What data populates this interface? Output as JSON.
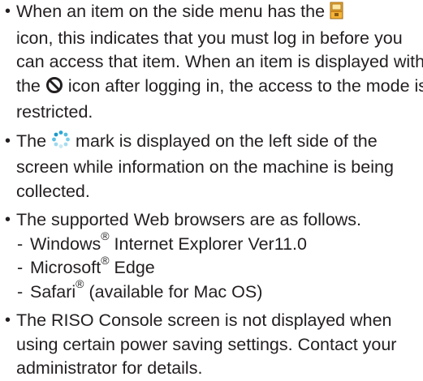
{
  "notes": [
    {
      "part1": "When an item on the side menu has the",
      "part2": "icon, this indicates that you must log in before you can access that item. When an item is displayed with the",
      "part3": "icon after logging in, the access to the mode is restricted."
    },
    {
      "part1": "The",
      "part2": "mark is displayed on the left side of the screen while information on the machine is being collected."
    },
    {
      "intro": "The supported Web browsers are as follows.",
      "browsers": [
        {
          "name": "Windows",
          "rest": "Internet Explorer Ver11.0"
        },
        {
          "name": "Microsoft",
          "rest": "Edge"
        },
        {
          "name": "Safari",
          "rest": "(available for Mac OS)"
        }
      ]
    },
    {
      "text": "The RISO Console screen is not displayed when using certain power saving settings. Contact your administrator for details."
    }
  ],
  "icons": [
    "lock-icon",
    "restricted-icon",
    "loading-spinner-icon"
  ],
  "colors": {
    "text": "#231f20",
    "spinner": "#2aa6d5",
    "lock": "#f5b335"
  }
}
